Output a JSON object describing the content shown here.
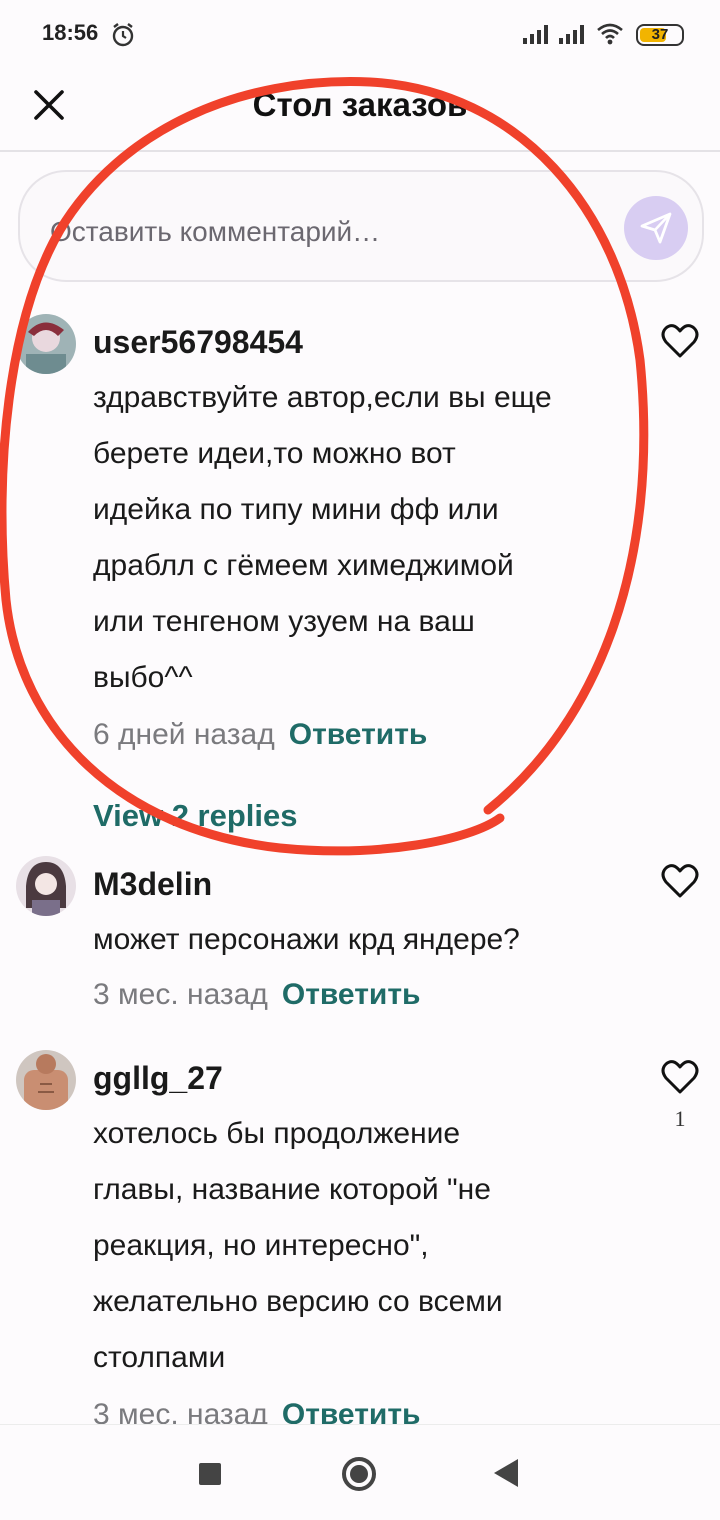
{
  "status_bar": {
    "time": "18:56",
    "battery": "37",
    "battery_color": "#f2b400",
    "icons": [
      "alarm-icon",
      "signal-icon",
      "signal-icon",
      "wifi-icon",
      "battery-icon"
    ]
  },
  "header": {
    "title": "Стол заказов",
    "close_icon": "close-icon"
  },
  "comment_input": {
    "placeholder": "Оставить комментарий…",
    "send_icon": "send-icon"
  },
  "comments": [
    {
      "username": "user56798454",
      "text_lines": [
        "здравствуйте автор,если вы еще",
        "берете идеи,то можно вот",
        "идейка по типу мини фф или",
        "драблл с гёмеем химеджимой",
        "или тенгеном узуем на ваш",
        "выбо^^"
      ],
      "time": "6 дней назад",
      "reply_label": "Ответить",
      "view_replies": "View 2 replies"
    },
    {
      "username": "M3delin",
      "text_lines": [
        "может персонажи крд яндере?"
      ],
      "time": "3 мес. назад",
      "reply_label": "Ответить"
    },
    {
      "username": "ggllg_27",
      "text_lines": [
        "хотелось бы продолжение",
        "главы, название которой \"не",
        "реакция, но интересно\",",
        "желательно версию со всеми",
        "столпами"
      ],
      "time": "3 мес. назад",
      "reply_label": "Ответить",
      "like_count": "1"
    }
  ],
  "colors": {
    "accent": "#1f6b67",
    "send_button": "#d8cdf2",
    "annotation": "#f0412b"
  },
  "nav_icons": [
    "recent-apps-icon",
    "home-icon",
    "back-icon"
  ]
}
